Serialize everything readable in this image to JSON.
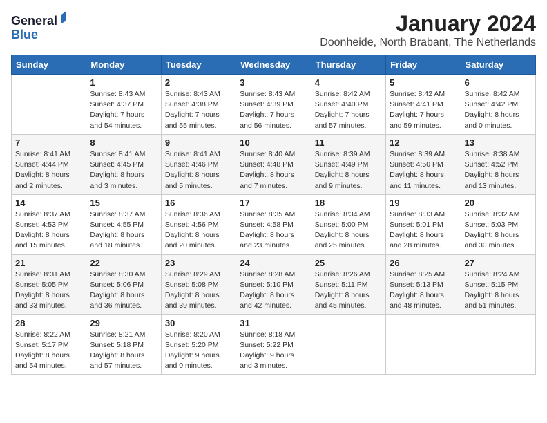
{
  "header": {
    "logo_line1": "General",
    "logo_line2": "Blue",
    "month_title": "January 2024",
    "subtitle": "Doonheide, North Brabant, The Netherlands"
  },
  "weekdays": [
    "Sunday",
    "Monday",
    "Tuesday",
    "Wednesday",
    "Thursday",
    "Friday",
    "Saturday"
  ],
  "weeks": [
    [
      {
        "day": "",
        "info": ""
      },
      {
        "day": "1",
        "info": "Sunrise: 8:43 AM\nSunset: 4:37 PM\nDaylight: 7 hours\nand 54 minutes."
      },
      {
        "day": "2",
        "info": "Sunrise: 8:43 AM\nSunset: 4:38 PM\nDaylight: 7 hours\nand 55 minutes."
      },
      {
        "day": "3",
        "info": "Sunrise: 8:43 AM\nSunset: 4:39 PM\nDaylight: 7 hours\nand 56 minutes."
      },
      {
        "day": "4",
        "info": "Sunrise: 8:42 AM\nSunset: 4:40 PM\nDaylight: 7 hours\nand 57 minutes."
      },
      {
        "day": "5",
        "info": "Sunrise: 8:42 AM\nSunset: 4:41 PM\nDaylight: 7 hours\nand 59 minutes."
      },
      {
        "day": "6",
        "info": "Sunrise: 8:42 AM\nSunset: 4:42 PM\nDaylight: 8 hours\nand 0 minutes."
      }
    ],
    [
      {
        "day": "7",
        "info": "Sunrise: 8:41 AM\nSunset: 4:44 PM\nDaylight: 8 hours\nand 2 minutes."
      },
      {
        "day": "8",
        "info": "Sunrise: 8:41 AM\nSunset: 4:45 PM\nDaylight: 8 hours\nand 3 minutes."
      },
      {
        "day": "9",
        "info": "Sunrise: 8:41 AM\nSunset: 4:46 PM\nDaylight: 8 hours\nand 5 minutes."
      },
      {
        "day": "10",
        "info": "Sunrise: 8:40 AM\nSunset: 4:48 PM\nDaylight: 8 hours\nand 7 minutes."
      },
      {
        "day": "11",
        "info": "Sunrise: 8:39 AM\nSunset: 4:49 PM\nDaylight: 8 hours\nand 9 minutes."
      },
      {
        "day": "12",
        "info": "Sunrise: 8:39 AM\nSunset: 4:50 PM\nDaylight: 8 hours\nand 11 minutes."
      },
      {
        "day": "13",
        "info": "Sunrise: 8:38 AM\nSunset: 4:52 PM\nDaylight: 8 hours\nand 13 minutes."
      }
    ],
    [
      {
        "day": "14",
        "info": "Sunrise: 8:37 AM\nSunset: 4:53 PM\nDaylight: 8 hours\nand 15 minutes."
      },
      {
        "day": "15",
        "info": "Sunrise: 8:37 AM\nSunset: 4:55 PM\nDaylight: 8 hours\nand 18 minutes."
      },
      {
        "day": "16",
        "info": "Sunrise: 8:36 AM\nSunset: 4:56 PM\nDaylight: 8 hours\nand 20 minutes."
      },
      {
        "day": "17",
        "info": "Sunrise: 8:35 AM\nSunset: 4:58 PM\nDaylight: 8 hours\nand 23 minutes."
      },
      {
        "day": "18",
        "info": "Sunrise: 8:34 AM\nSunset: 5:00 PM\nDaylight: 8 hours\nand 25 minutes."
      },
      {
        "day": "19",
        "info": "Sunrise: 8:33 AM\nSunset: 5:01 PM\nDaylight: 8 hours\nand 28 minutes."
      },
      {
        "day": "20",
        "info": "Sunrise: 8:32 AM\nSunset: 5:03 PM\nDaylight: 8 hours\nand 30 minutes."
      }
    ],
    [
      {
        "day": "21",
        "info": "Sunrise: 8:31 AM\nSunset: 5:05 PM\nDaylight: 8 hours\nand 33 minutes."
      },
      {
        "day": "22",
        "info": "Sunrise: 8:30 AM\nSunset: 5:06 PM\nDaylight: 8 hours\nand 36 minutes."
      },
      {
        "day": "23",
        "info": "Sunrise: 8:29 AM\nSunset: 5:08 PM\nDaylight: 8 hours\nand 39 minutes."
      },
      {
        "day": "24",
        "info": "Sunrise: 8:28 AM\nSunset: 5:10 PM\nDaylight: 8 hours\nand 42 minutes."
      },
      {
        "day": "25",
        "info": "Sunrise: 8:26 AM\nSunset: 5:11 PM\nDaylight: 8 hours\nand 45 minutes."
      },
      {
        "day": "26",
        "info": "Sunrise: 8:25 AM\nSunset: 5:13 PM\nDaylight: 8 hours\nand 48 minutes."
      },
      {
        "day": "27",
        "info": "Sunrise: 8:24 AM\nSunset: 5:15 PM\nDaylight: 8 hours\nand 51 minutes."
      }
    ],
    [
      {
        "day": "28",
        "info": "Sunrise: 8:22 AM\nSunset: 5:17 PM\nDaylight: 8 hours\nand 54 minutes."
      },
      {
        "day": "29",
        "info": "Sunrise: 8:21 AM\nSunset: 5:18 PM\nDaylight: 8 hours\nand 57 minutes."
      },
      {
        "day": "30",
        "info": "Sunrise: 8:20 AM\nSunset: 5:20 PM\nDaylight: 9 hours\nand 0 minutes."
      },
      {
        "day": "31",
        "info": "Sunrise: 8:18 AM\nSunset: 5:22 PM\nDaylight: 9 hours\nand 3 minutes."
      },
      {
        "day": "",
        "info": ""
      },
      {
        "day": "",
        "info": ""
      },
      {
        "day": "",
        "info": ""
      }
    ]
  ]
}
